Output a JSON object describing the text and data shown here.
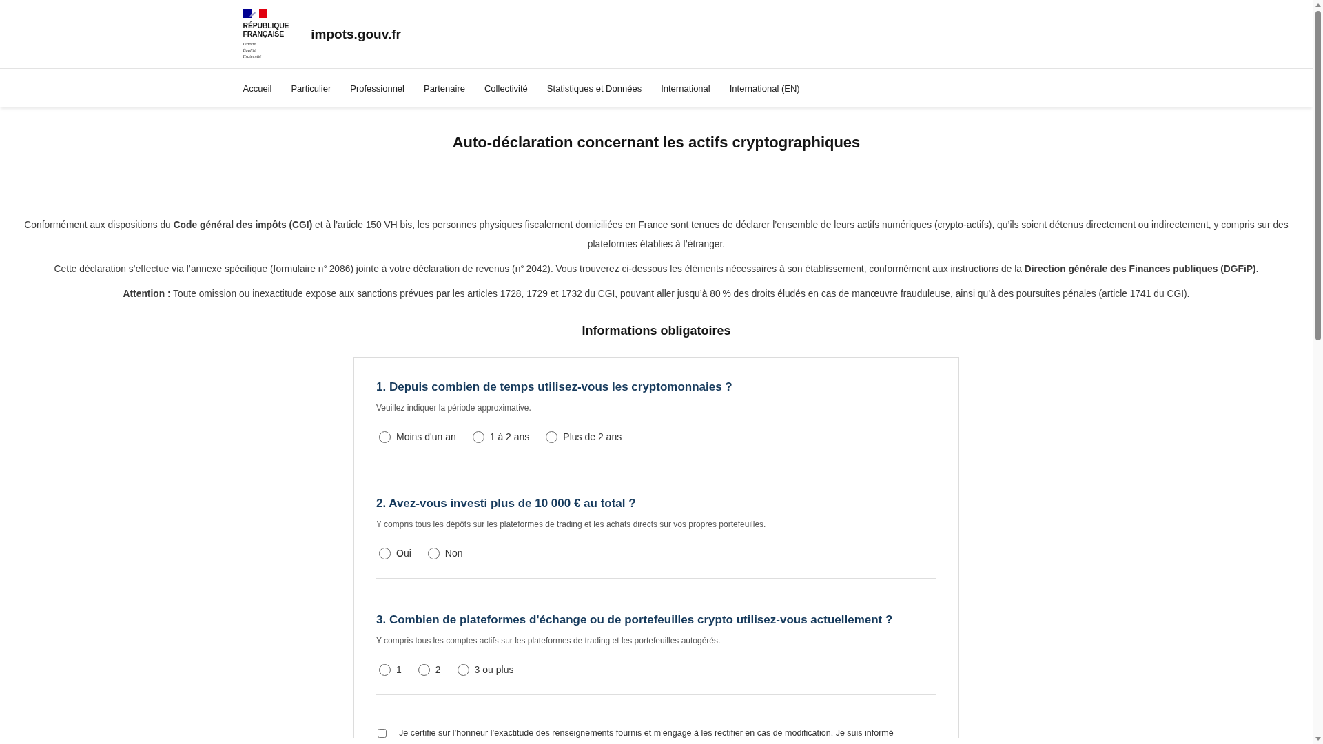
{
  "header": {
    "logo": {
      "name": "RÉPUBLIQUE FRANÇAISE",
      "motto": "Liberté Égalité Fraternité"
    },
    "site_name": "impots.gouv.fr"
  },
  "nav": {
    "items": [
      "Accueil",
      "Particulier",
      "Professionnel",
      "Partenaire",
      "Collectivité",
      "Statistiques et Données",
      "International",
      "International (EN)"
    ]
  },
  "page_title": "Auto-déclaration concernant les actifs cryptographiques",
  "intro": [
    "Conformément aux dispositions du **Code général des impôts (CGI)** et à l’article 150 VH bis, les personnes physiques fiscalement domiciliées en France sont tenues de déclarer l’ensemble de leurs actifs numériques (crypto-actifs), qu’ils soient détenus directement ou indirectement, y compris sur des plateformes établies à l’étranger.",
    "Cette déclaration s’effectue via l’annexe spécifique (formulaire n° 2086) jointe à votre déclaration de revenus (n° 2042). Vous trouverez ci-dessous les éléments nécessaires à son établissement, conformément aux instructions de la **Direction générale des Finances publiques (DGFiP)**.",
    "**Attention :** Toute omission ou inexactitude expose aux sanctions prévues par les articles 1728, 1729 et 1732 du CGI, pouvant aller jusqu’à 80 % des droits éludés en cas de manœuvre frauduleuse, ainsi qu’à des poursuites pénales (article 1741 du CGI)."
  ],
  "section_title": "Informations obligatoires",
  "form": {
    "questions": [
      {
        "title": "1. Depuis combien de temps utilisez-vous les cryptomonnaies ?",
        "hint": "Veuillez indiquer la période approximative.",
        "options": [
          {
            "label": "Moins d'un an",
            "selected": false
          },
          {
            "label": "1 à 2 ans",
            "selected": false
          },
          {
            "label": "Plus de 2 ans",
            "selected": false
          }
        ]
      },
      {
        "title": "2. Avez-vous investi plus de 10 000 € au total ?",
        "hint": "Y compris tous les dépôts sur les plateformes de trading et les achats directs sur vos propres portefeuilles.",
        "options": [
          {
            "label": "Oui",
            "selected": false
          },
          {
            "label": "Non",
            "selected": false
          }
        ]
      },
      {
        "title": "3. Combien de plateformes d'échange ou de portefeuilles crypto utilisez-vous actuellement ?",
        "hint": "Y compris tous les comptes actifs sur les plateformes de trading et les portefeuilles autogérés.",
        "options": [
          {
            "label": "1",
            "selected": false
          },
          {
            "label": "2",
            "selected": false
          },
          {
            "label": "3 ou plus",
            "selected": false
          }
        ]
      }
    ],
    "certification": {
      "text": "Je certifie sur l’honneur l’exactitude des renseignements fournis et m’engage à les rectifier en cas de modification. Je suis informé",
      "checked": false
    }
  }
}
